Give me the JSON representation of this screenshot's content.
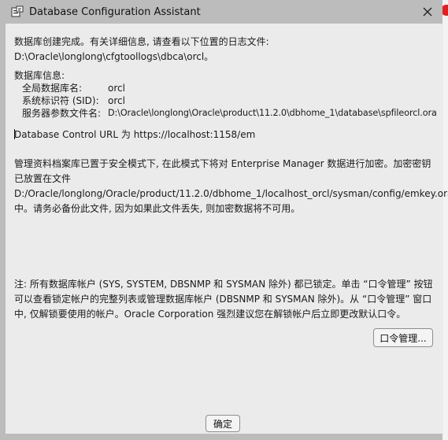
{
  "window": {
    "title": "Database Configuration Assistant",
    "icon": "dbca-app-icon",
    "close_icon": "close-icon"
  },
  "content": {
    "completion_line": "数据库创建完成。有关详细信息, 请查看以下位置的日志文件:",
    "log_path": " D:\\Oracle\\longlong\\cfgtoollogs\\dbca\\orcl。",
    "db_info_header": "数据库信息:",
    "db_info": [
      {
        "label": "全局数据库名:",
        "value": "orcl"
      },
      {
        "label": "系统标识符 (SID):",
        "value": "orcl"
      },
      {
        "label": "服务器参数文件名:",
        "value": "D:\\Oracle\\longlong\\Oracle\\product\\11.2.0\\dbhome_1\\database\\spfileorcl.ora"
      }
    ],
    "control_url": "Database Control URL 为 https://localhost:1158/em",
    "secure_mode_text": "管理资料档案库已置于安全模式下, 在此模式下将对 Enterprise Manager 数据进行加密。加密密钥已放置在文件 D:/Oracle/longlong/Oracle/product/11.2.0/dbhome_1/localhost_orcl/sysman/config/emkey.ora 中。请务必备份此文件, 因为如果此文件丢失, 则加密数据将不可用。",
    "note_text": "注: 所有数据库帐户 (SYS, SYSTEM, DBSNMP 和 SYSMAN 除外) 都已锁定。单击 “口令管理” 按钮可以查看锁定帐户的完整列表或管理数据库帐户 (DBSNMP 和 SYSMAN 除外)。从 “口令管理” 窗口中, 仅解锁要使用的帐户。Oracle Corporation 强烈建议您在解锁帐户后立即更改默认口令。"
  },
  "buttons": {
    "password_management": "口令管理...",
    "ok": "确定"
  },
  "colors": {
    "title_bar": "#bcbcbc",
    "content_bg": "#ebebeb",
    "button_bg": "#f4f4f4",
    "edge_badge": "#e02020"
  }
}
